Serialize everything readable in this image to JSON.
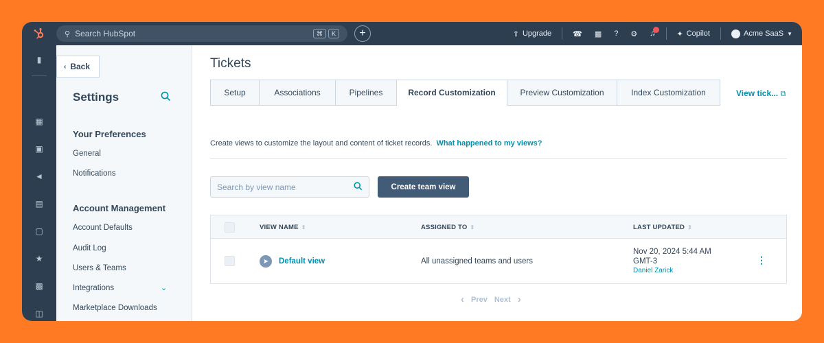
{
  "topbar": {
    "search_placeholder": "Search HubSpot",
    "kbd_keys": [
      "⌘",
      "K"
    ],
    "upgrade_label": "Upgrade",
    "copilot_label": "Copilot",
    "account_label": "Acme SaaS"
  },
  "sidebar": {
    "back_label": "Back",
    "title": "Settings",
    "sections": [
      {
        "heading": "Your Preferences",
        "items": [
          "General",
          "Notifications"
        ]
      },
      {
        "heading": "Account Management",
        "items": [
          "Account Defaults",
          "Audit Log",
          "Users & Teams",
          "Integrations",
          "Marketplace Downloads"
        ]
      }
    ]
  },
  "main": {
    "title": "Tickets",
    "tabs": [
      {
        "label": "Setup",
        "active": false
      },
      {
        "label": "Associations",
        "active": false
      },
      {
        "label": "Pipelines",
        "active": false
      },
      {
        "label": "Record Customization",
        "active": true
      },
      {
        "label": "Preview Customization",
        "active": false
      },
      {
        "label": "Index Customization",
        "active": false
      }
    ],
    "view_tickets_link": "View tick...",
    "description": "Create views to customize the layout and content of ticket records.",
    "help_link": "What happened to my views?",
    "search_placeholder": "Search by view name",
    "create_button": "Create team view",
    "table": {
      "columns": [
        "VIEW NAME",
        "ASSIGNED TO",
        "LAST UPDATED"
      ],
      "rows": [
        {
          "view_name": "Default view",
          "assigned_to": "All unassigned teams and users",
          "updated_date": "Nov 20, 2024 5:44 AM",
          "updated_tz": "GMT-3",
          "updated_by": "Daniel Zarick"
        }
      ]
    },
    "pager": {
      "prev": "Prev",
      "next": "Next"
    }
  },
  "colors": {
    "background": "#ff7a23",
    "topbar": "#2d3e50",
    "accent": "#0091ae",
    "button": "#425b76"
  }
}
